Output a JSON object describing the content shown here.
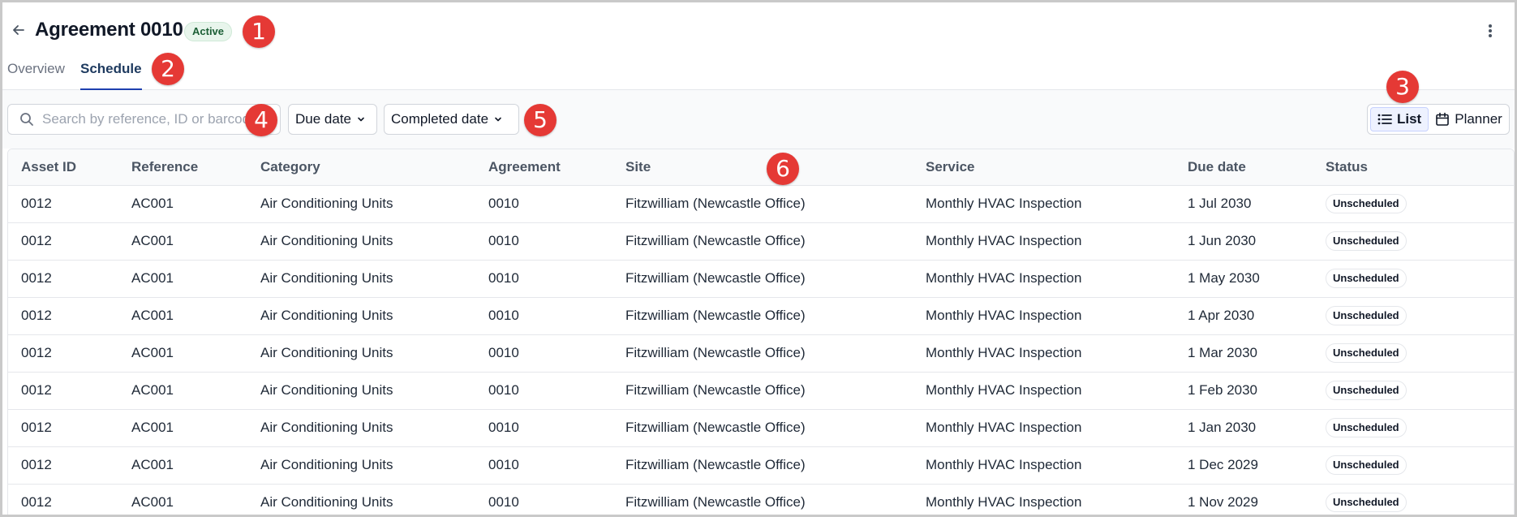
{
  "header": {
    "title": "Agreement 0010",
    "status_badge": "Active"
  },
  "tabs": [
    {
      "label": "Overview",
      "active": false
    },
    {
      "label": "Schedule",
      "active": true
    }
  ],
  "toolbar": {
    "search_placeholder": "Search by reference, ID or barcode",
    "filter_due_label": "Due date",
    "filter_completed_label": "Completed date",
    "view_list_label": "List",
    "view_planner_label": "Planner"
  },
  "table": {
    "columns": [
      "Asset ID",
      "Reference",
      "Category",
      "Agreement",
      "Site",
      "Service",
      "Due date",
      "Status"
    ],
    "rows": [
      [
        "0012",
        "AC001",
        "Air Conditioning Units",
        "0010",
        "Fitzwilliam (Newcastle Office)",
        "Monthly HVAC Inspection",
        "1 Jul 2030",
        "Unscheduled"
      ],
      [
        "0012",
        "AC001",
        "Air Conditioning Units",
        "0010",
        "Fitzwilliam (Newcastle Office)",
        "Monthly HVAC Inspection",
        "1 Jun 2030",
        "Unscheduled"
      ],
      [
        "0012",
        "AC001",
        "Air Conditioning Units",
        "0010",
        "Fitzwilliam (Newcastle Office)",
        "Monthly HVAC Inspection",
        "1 May 2030",
        "Unscheduled"
      ],
      [
        "0012",
        "AC001",
        "Air Conditioning Units",
        "0010",
        "Fitzwilliam (Newcastle Office)",
        "Monthly HVAC Inspection",
        "1 Apr 2030",
        "Unscheduled"
      ],
      [
        "0012",
        "AC001",
        "Air Conditioning Units",
        "0010",
        "Fitzwilliam (Newcastle Office)",
        "Monthly HVAC Inspection",
        "1 Mar 2030",
        "Unscheduled"
      ],
      [
        "0012",
        "AC001",
        "Air Conditioning Units",
        "0010",
        "Fitzwilliam (Newcastle Office)",
        "Monthly HVAC Inspection",
        "1 Feb 2030",
        "Unscheduled"
      ],
      [
        "0012",
        "AC001",
        "Air Conditioning Units",
        "0010",
        "Fitzwilliam (Newcastle Office)",
        "Monthly HVAC Inspection",
        "1 Jan 2030",
        "Unscheduled"
      ],
      [
        "0012",
        "AC001",
        "Air Conditioning Units",
        "0010",
        "Fitzwilliam (Newcastle Office)",
        "Monthly HVAC Inspection",
        "1 Dec 2029",
        "Unscheduled"
      ],
      [
        "0012",
        "AC001",
        "Air Conditioning Units",
        "0010",
        "Fitzwilliam (Newcastle Office)",
        "Monthly HVAC Inspection",
        "1 Nov 2029",
        "Unscheduled"
      ]
    ]
  },
  "markers": [
    "1",
    "2",
    "3",
    "4",
    "5",
    "6"
  ],
  "icons": {
    "back": "arrow-left-icon",
    "more": "more-vertical-icon",
    "search": "search-icon",
    "chevron": "chevron-down-icon",
    "list": "list-icon",
    "planner": "calendar-icon"
  },
  "colors": {
    "marker": "#e53935",
    "active_tab": "#1e40af",
    "status_active_bg": "#e8f5ec"
  }
}
